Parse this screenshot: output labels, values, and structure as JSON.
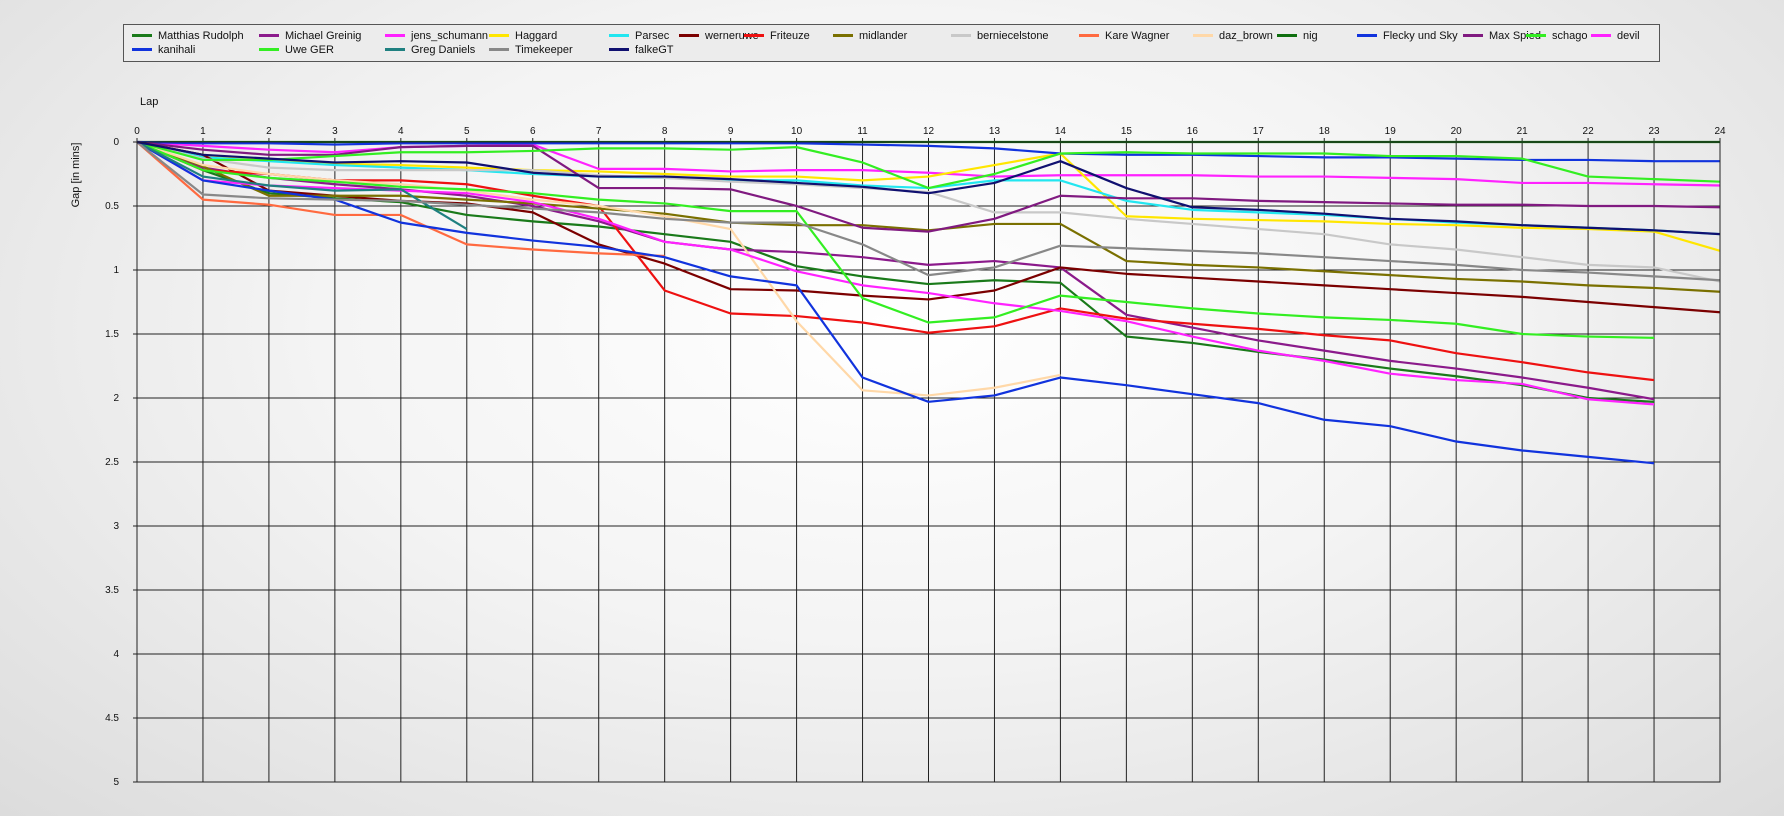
{
  "chart_data": {
    "type": "line",
    "xlabel": "Lap",
    "ylabel": "Gap [in mins]",
    "xlim": [
      0,
      24
    ],
    "ylim": [
      0,
      5
    ],
    "y_inverted": true,
    "grid": true,
    "legend_position": "top",
    "x_ticks": [
      "0",
      "1",
      "2",
      "3",
      "4",
      "5",
      "6",
      "7",
      "8",
      "9",
      "10",
      "11",
      "12",
      "13",
      "14",
      "15",
      "16",
      "17",
      "18",
      "19",
      "20",
      "21",
      "22",
      "23",
      "24"
    ],
    "y_ticks": [
      "0",
      "0.5",
      "1",
      "1.5",
      "2",
      "2.5",
      "3",
      "3.5",
      "4",
      "4.5",
      "5"
    ],
    "series": [
      {
        "name": "Matthias Rudolph",
        "color": "#1a7a1a",
        "values": [
          0,
          0.22,
          0.4,
          0.44,
          0.47,
          0.57,
          0.62,
          0.66,
          0.72,
          0.78,
          0.97,
          1.05,
          1.11,
          1.08,
          1.1,
          1.52,
          1.57,
          1.64,
          1.7,
          1.77,
          1.83,
          1.9,
          2.0,
          2.03
        ]
      },
      {
        "name": "Michael Greinig",
        "color": "#8b1a8b",
        "values": [
          0,
          0.2,
          0.28,
          0.33,
          0.37,
          0.42,
          0.5,
          0.62,
          0.78,
          0.84,
          0.86,
          0.9,
          0.96,
          0.93,
          0.98,
          1.35,
          1.45,
          1.55,
          1.63,
          1.71,
          1.77,
          1.84,
          1.92,
          2.01
        ]
      },
      {
        "name": "jens_schumann",
        "color": "#ff22ff",
        "values": [
          0,
          0.03,
          0.06,
          0.08,
          0.04,
          0.03,
          0.02,
          0.21,
          0.21,
          0.23,
          0.22,
          0.22,
          0.24,
          0.27,
          0.26,
          0.26,
          0.26,
          0.27,
          0.27,
          0.28,
          0.29,
          0.32,
          0.32,
          0.33,
          0.34
        ]
      },
      {
        "name": "Haggard",
        "color": "#ffe600",
        "values": [
          0,
          0.1,
          0.14,
          0.17,
          0.18,
          0.2,
          0.22,
          0.23,
          0.25,
          0.27,
          0.27,
          0.3,
          0.27,
          0.18,
          0.09,
          0.58,
          0.6,
          0.61,
          0.62,
          0.64,
          0.65,
          0.67,
          0.68,
          0.7,
          0.85
        ]
      },
      {
        "name": "Parsec",
        "color": "#22e6f0",
        "values": [
          0,
          0.12,
          0.15,
          0.18,
          0.2,
          0.22,
          0.25,
          0.27,
          0.28,
          0.3,
          0.3,
          0.34,
          0.36,
          0.3,
          0.3,
          0.46,
          0.53,
          0.55,
          0.57,
          0.6,
          0.63,
          0.65,
          0.67,
          0.69,
          0.72
        ]
      },
      {
        "name": "werneruwe",
        "color": "#7b0000",
        "values": [
          0,
          0.1,
          0.38,
          0.42,
          0.46,
          0.48,
          0.55,
          0.8,
          0.95,
          1.15,
          1.16,
          1.2,
          1.23,
          1.16,
          0.98,
          1.03,
          1.06,
          1.09,
          1.12,
          1.15,
          1.18,
          1.21,
          1.25,
          1.29,
          1.33
        ]
      },
      {
        "name": "Friteuze",
        "color": "#ee1111",
        "values": [
          0,
          0.22,
          0.25,
          0.3,
          0.3,
          0.33,
          0.42,
          0.5,
          1.16,
          1.34,
          1.36,
          1.41,
          1.49,
          1.44,
          1.3,
          1.38,
          1.42,
          1.46,
          1.51,
          1.55,
          1.65,
          1.72,
          1.8,
          1.86
        ]
      },
      {
        "name": "midlander",
        "color": "#7a7000",
        "values": [
          0,
          0.19,
          0.42,
          0.42,
          0.42,
          0.45,
          0.48,
          0.52,
          0.56,
          0.63,
          0.65,
          0.65,
          0.69,
          0.64,
          0.64,
          0.93,
          0.96,
          0.98,
          1.01,
          1.04,
          1.07,
          1.09,
          1.12,
          1.14,
          1.17
        ]
      },
      {
        "name": "berniecelstone",
        "color": "#c8c8c8",
        "values": [
          0,
          0.13,
          0.2,
          0.22,
          0.22,
          0.22,
          0.22,
          0.26,
          0.28,
          0.31,
          0.33,
          0.36,
          0.39,
          0.55,
          0.55,
          0.6,
          0.64,
          0.68,
          0.72,
          0.8,
          0.84,
          0.9,
          0.96,
          0.98,
          1.09
        ]
      },
      {
        "name": "Kare Wagner",
        "color": "#ff6a40",
        "values": [
          0,
          0.45,
          0.49,
          0.57,
          0.57,
          0.8,
          0.84,
          0.87,
          0.89
        ]
      },
      {
        "name": "daz_brown",
        "color": "#ffd8a8",
        "values": [
          0,
          0.18,
          0.25,
          0.3,
          0.33,
          0.38,
          0.45,
          0.5,
          0.58,
          0.68,
          1.4,
          1.94,
          1.98,
          1.92,
          1.82
        ]
      },
      {
        "name": "nig",
        "color": "#0f6f0f",
        "values": [
          0,
          0,
          0,
          0,
          0,
          0,
          0,
          0,
          0,
          0,
          0,
          0,
          0,
          0,
          0,
          0,
          0,
          0,
          0,
          0,
          0,
          0,
          0,
          0,
          0
        ]
      },
      {
        "name": "Flecky und Sky",
        "color": "#1133dd",
        "values": [
          0,
          0.01,
          0.01,
          0.02,
          0.01,
          0.01,
          0.01,
          0.01,
          0.01,
          0.01,
          0.01,
          0.02,
          0.03,
          0.05,
          0.09,
          0.1,
          0.1,
          0.11,
          0.12,
          0.12,
          0.13,
          0.14,
          0.14,
          0.15,
          0.15
        ]
      },
      {
        "name": "Max Spied",
        "color": "#801a80",
        "values": [
          0,
          0.06,
          0.1,
          0.1,
          0.04,
          0.03,
          0.03,
          0.36,
          0.36,
          0.37,
          0.5,
          0.67,
          0.7,
          0.6,
          0.42,
          0.44,
          0.44,
          0.46,
          0.47,
          0.48,
          0.49,
          0.49,
          0.5,
          0.5,
          0.51
        ]
      },
      {
        "name": "schago",
        "color": "#33ee22",
        "values": [
          0,
          0.14,
          0.14,
          0.11,
          0.08,
          0.08,
          0.07,
          0.05,
          0.05,
          0.06,
          0.04,
          0.16,
          0.36,
          0.25,
          0.09,
          0.08,
          0.09,
          0.09,
          0.09,
          0.11,
          0.11,
          0.13,
          0.27,
          0.29,
          0.31
        ]
      },
      {
        "name": "devil",
        "color": "#ff22ff",
        "values": [
          0,
          0.3,
          0.34,
          0.36,
          0.38,
          0.4,
          0.47,
          0.6,
          0.78,
          0.84,
          1.01,
          1.12,
          1.18,
          1.26,
          1.32,
          1.4,
          1.52,
          1.63,
          1.71,
          1.81,
          1.86,
          1.89,
          2.01,
          2.05
        ]
      },
      {
        "name": "kanihali",
        "color": "#1133dd",
        "values": [
          0,
          0.3,
          0.38,
          0.45,
          0.63,
          0.71,
          0.77,
          0.82,
          0.9,
          1.05,
          1.12,
          1.84,
          2.03,
          1.98,
          1.84,
          1.9,
          1.97,
          2.04,
          2.17,
          2.22,
          2.34,
          2.41,
          2.46,
          2.51
        ]
      },
      {
        "name": "Uwe GER",
        "color": "#33ee22",
        "values": [
          0,
          0.22,
          0.28,
          0.31,
          0.35,
          0.37,
          0.4,
          0.45,
          0.48,
          0.54,
          0.54,
          1.22,
          1.41,
          1.37,
          1.2,
          1.25,
          1.3,
          1.34,
          1.37,
          1.39,
          1.42,
          1.5,
          1.52,
          1.53
        ]
      },
      {
        "name": "Greg Daniels",
        "color": "#1f8080",
        "values": [
          0,
          0.27,
          0.34,
          0.38,
          0.37,
          0.68
        ]
      },
      {
        "name": "Timekeeper",
        "color": "#888888",
        "values": [
          0,
          0.41,
          0.44,
          0.45,
          0.46,
          0.49,
          0.52,
          0.55,
          0.6,
          0.63,
          0.63,
          0.8,
          1.04,
          0.98,
          0.81,
          0.83,
          0.85,
          0.87,
          0.9,
          0.93,
          0.96,
          1.0,
          1.02,
          1.05,
          1.08
        ]
      },
      {
        "name": "falkeGT",
        "color": "#101070",
        "values": [
          0,
          0.1,
          0.13,
          0.16,
          0.15,
          0.16,
          0.24,
          0.27,
          0.27,
          0.29,
          0.32,
          0.35,
          0.4,
          0.32,
          0.15,
          0.36,
          0.51,
          0.53,
          0.56,
          0.6,
          0.62,
          0.65,
          0.67,
          0.69,
          0.72
        ]
      }
    ]
  }
}
